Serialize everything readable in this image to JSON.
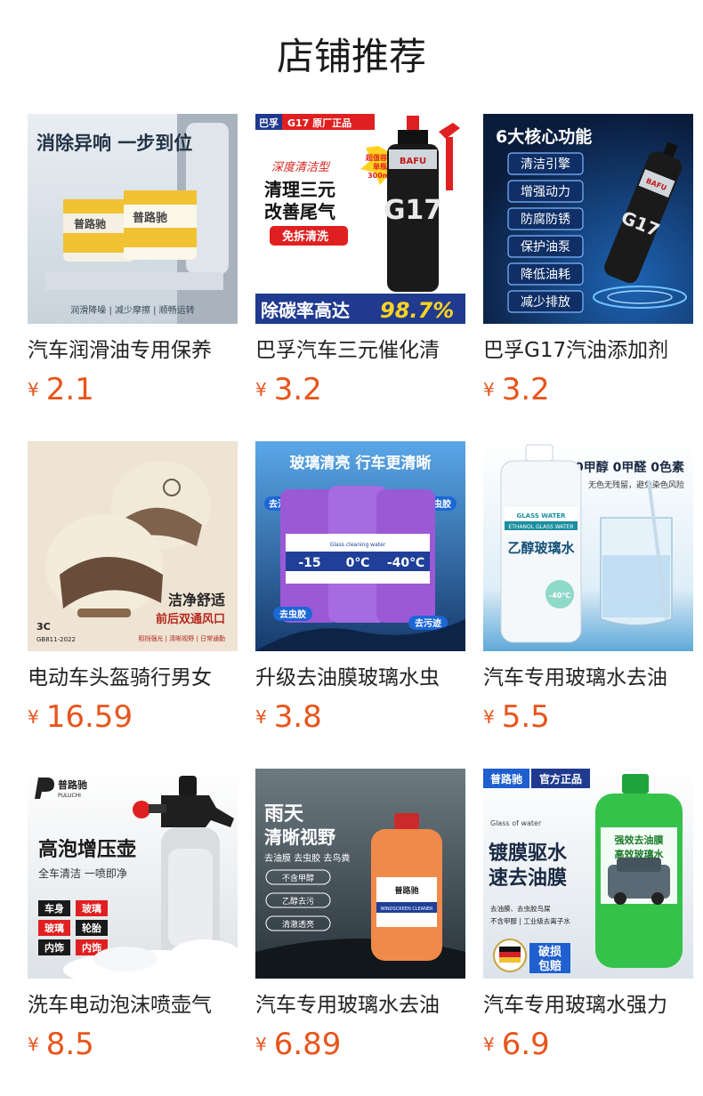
{
  "header": {
    "title": "店铺推荐"
  },
  "currency_symbol": "¥",
  "products": [
    {
      "title": "汽车润滑油专用保养",
      "price": "2.1",
      "image": {
        "headline": "消除异响 一步到位",
        "brand": "普路驰",
        "footer": "润滑降噪 | 减少摩擦 | 顺畅运转"
      }
    },
    {
      "title": "巴孚汽车三元催化清",
      "price": "3.2",
      "image": {
        "brand_tag": "巴孚",
        "model_tag": "G17 原厂正品",
        "subtitle": "深度清洁型",
        "line1": "清理三元",
        "line2": "改善尾气",
        "chip": "免拆清洗",
        "burst_line1": "超值容量",
        "burst_line2": "单瓶",
        "burst_line3": "300ml",
        "bottle_brand": "BAFU",
        "bottle_model": "G17",
        "footer_text": "除碳率高达",
        "footer_value": "98.7%"
      }
    },
    {
      "title": "巴孚G17汽油添加剂",
      "price": "3.2",
      "image": {
        "headline": "6大核心功能",
        "features": [
          "清洁引擎",
          "增强动力",
          "防腐防锈",
          "保护油泵",
          "降低油耗",
          "减少排放"
        ],
        "bottle_brand": "BAFU",
        "bottle_model": "G17"
      }
    },
    {
      "title": "电动车头盔骑行男女",
      "price": "16.59",
      "image": {
        "line1": "洁净舒适",
        "line2": "前后双通风口",
        "cert": "3C",
        "cert_code": "GB811-2022",
        "footer": "阻挡强光 | 清晰视野 | 日常通勤"
      }
    },
    {
      "title": "升级去油膜玻璃水虫",
      "price": "3.8",
      "image": {
        "headline": "玻璃清亮 行车更清晰",
        "tag_left": "去油膜",
        "tag_right": "去虫胶",
        "tag_bottom_left": "去虫胶",
        "tag_bottom_right": "去污迹",
        "label_left": "-15",
        "label_mid": "0℃",
        "label_right": "-40℃",
        "label_caption": "Glass cleaning water"
      }
    },
    {
      "title": "汽车专用玻璃水去油",
      "price": "5.5",
      "image": {
        "headline": "0甲醇 0甲醛 0色素",
        "subline": "无色无残留，避免染色风险",
        "label_en1": "GLASS WATER",
        "label_en2": "ETHANOL GLASS WATER",
        "label_cn": "乙醇玻璃水",
        "temp": "-40℃"
      }
    },
    {
      "title": "洗车电动泡沫喷壶气",
      "price": "8.5",
      "image": {
        "brand": "普路驰",
        "brand_en": "PULUCHI",
        "headline": "高泡增压壶",
        "subline": "全车清洁 一喷即净",
        "tags": [
          "车身",
          "玻璃",
          "玻璃",
          "轮胎",
          "内饰",
          "内饰"
        ]
      }
    },
    {
      "title": "汽车专用玻璃水去油",
      "price": "6.89",
      "image": {
        "line1": "雨天",
        "line2": "清晰视野",
        "subline": "去油膜 去虫胶 去鸟粪",
        "checks": [
          "不含甲醇",
          "乙醇去污",
          "清澈透亮"
        ],
        "bottle_brand": "普路驰",
        "bottle_label": "WINDSCREEN CLEANER"
      }
    },
    {
      "title": "汽车专用玻璃水强力",
      "price": "6.9",
      "image": {
        "brand_tag": "普路驰",
        "official_tag": "官方正品",
        "caption_en": "Glass of water",
        "line1": "镀膜驱水",
        "line2": "速去油膜",
        "bullet1": "去油膜、去虫胶鸟屎",
        "bullet2": "不含甲醇 | 工业级去离子水",
        "guarantee1": "破损",
        "guarantee2": "包赔",
        "bottle_label1": "强效去油膜",
        "bottle_label2": "高效玻璃水"
      }
    }
  ]
}
